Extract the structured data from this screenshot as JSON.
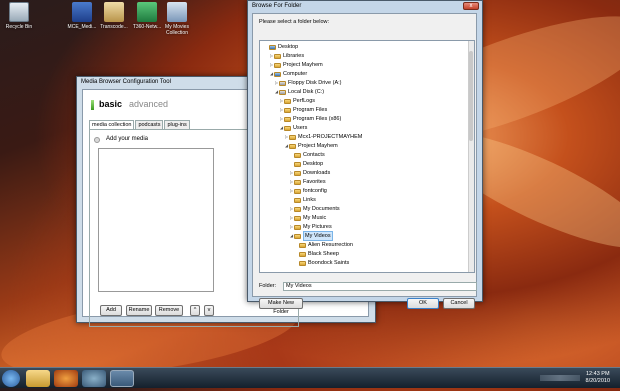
{
  "desktop": {
    "icons": [
      {
        "label": "Recycle Bin",
        "icon": "recycle-bin-icon"
      },
      {
        "label": "MCE_Medi...",
        "icon": "installer-icon"
      },
      {
        "label": "Transcode...",
        "icon": "box-icon"
      },
      {
        "label": "T360-Netw...",
        "icon": "network-icon"
      },
      {
        "label": "My Movies Collection",
        "icon": "movies-icon"
      }
    ]
  },
  "media_browser": {
    "title": "Media Browser Configuration Tool",
    "mode_basic": "basic",
    "mode_advanced": "advanced",
    "tabs": [
      "media collection",
      "podcasts",
      "plug-ins"
    ],
    "add_media_label": "Add your media",
    "buttons": {
      "add": "Add",
      "rename": "Rename",
      "remove": "Remove",
      "up": "^",
      "down": "v"
    }
  },
  "browse_dialog": {
    "title": "Browse For Folder",
    "close": "x",
    "prompt": "Please select a folder below:",
    "tree": [
      {
        "label": "Desktop",
        "depth": 0,
        "arrow": "",
        "icon": "desktop"
      },
      {
        "label": "Libraries",
        "depth": 1,
        "arrow": "▷",
        "icon": "folder"
      },
      {
        "label": "Project Mayhem",
        "depth": 1,
        "arrow": "▷",
        "icon": "folder"
      },
      {
        "label": "Computer",
        "depth": 1,
        "arrow": "◢",
        "icon": "computer"
      },
      {
        "label": "Floppy Disk Drive (A:)",
        "depth": 2,
        "arrow": "▷",
        "icon": "drive"
      },
      {
        "label": "Local Disk (C:)",
        "depth": 2,
        "arrow": "◢",
        "icon": "drive"
      },
      {
        "label": "PerfLogs",
        "depth": 3,
        "arrow": "▷",
        "icon": "folder"
      },
      {
        "label": "Program Files",
        "depth": 3,
        "arrow": "▷",
        "icon": "folder"
      },
      {
        "label": "Program Files (x86)",
        "depth": 3,
        "arrow": "▷",
        "icon": "folder"
      },
      {
        "label": "Users",
        "depth": 3,
        "arrow": "◢",
        "icon": "folder"
      },
      {
        "label": "Mcx1-PROJECTMAYHEM",
        "depth": 4,
        "arrow": "▷",
        "icon": "folder"
      },
      {
        "label": "Project Mayhem",
        "depth": 4,
        "arrow": "◢",
        "icon": "folder"
      },
      {
        "label": "Contacts",
        "depth": 5,
        "arrow": "",
        "icon": "folder"
      },
      {
        "label": "Desktop",
        "depth": 5,
        "arrow": "",
        "icon": "folder"
      },
      {
        "label": "Downloads",
        "depth": 5,
        "arrow": "▷",
        "icon": "folder"
      },
      {
        "label": "Favorites",
        "depth": 5,
        "arrow": "▷",
        "icon": "folder"
      },
      {
        "label": "fontconfig",
        "depth": 5,
        "arrow": "▷",
        "icon": "folder"
      },
      {
        "label": "Links",
        "depth": 5,
        "arrow": "",
        "icon": "folder"
      },
      {
        "label": "My Documents",
        "depth": 5,
        "arrow": "▷",
        "icon": "folder"
      },
      {
        "label": "My Music",
        "depth": 5,
        "arrow": "▷",
        "icon": "folder"
      },
      {
        "label": "My Pictures",
        "depth": 5,
        "arrow": "▷",
        "icon": "folder"
      },
      {
        "label": "My Videos",
        "depth": 5,
        "arrow": "◢",
        "icon": "folder",
        "selected": true
      },
      {
        "label": "Alien Resurrection",
        "depth": 6,
        "arrow": "",
        "icon": "folder"
      },
      {
        "label": "Black Sheep",
        "depth": 6,
        "arrow": "",
        "icon": "folder"
      },
      {
        "label": "Boondock Saints",
        "depth": 6,
        "arrow": "",
        "icon": "folder"
      }
    ],
    "folder_label": "Folder:",
    "folder_value": "My Videos",
    "new_folder_button": "Make New Folder",
    "ok_button": "OK",
    "cancel_button": "Cancel"
  },
  "taskbar": {
    "time": "12:43 PM",
    "date": "8/20/2010"
  }
}
